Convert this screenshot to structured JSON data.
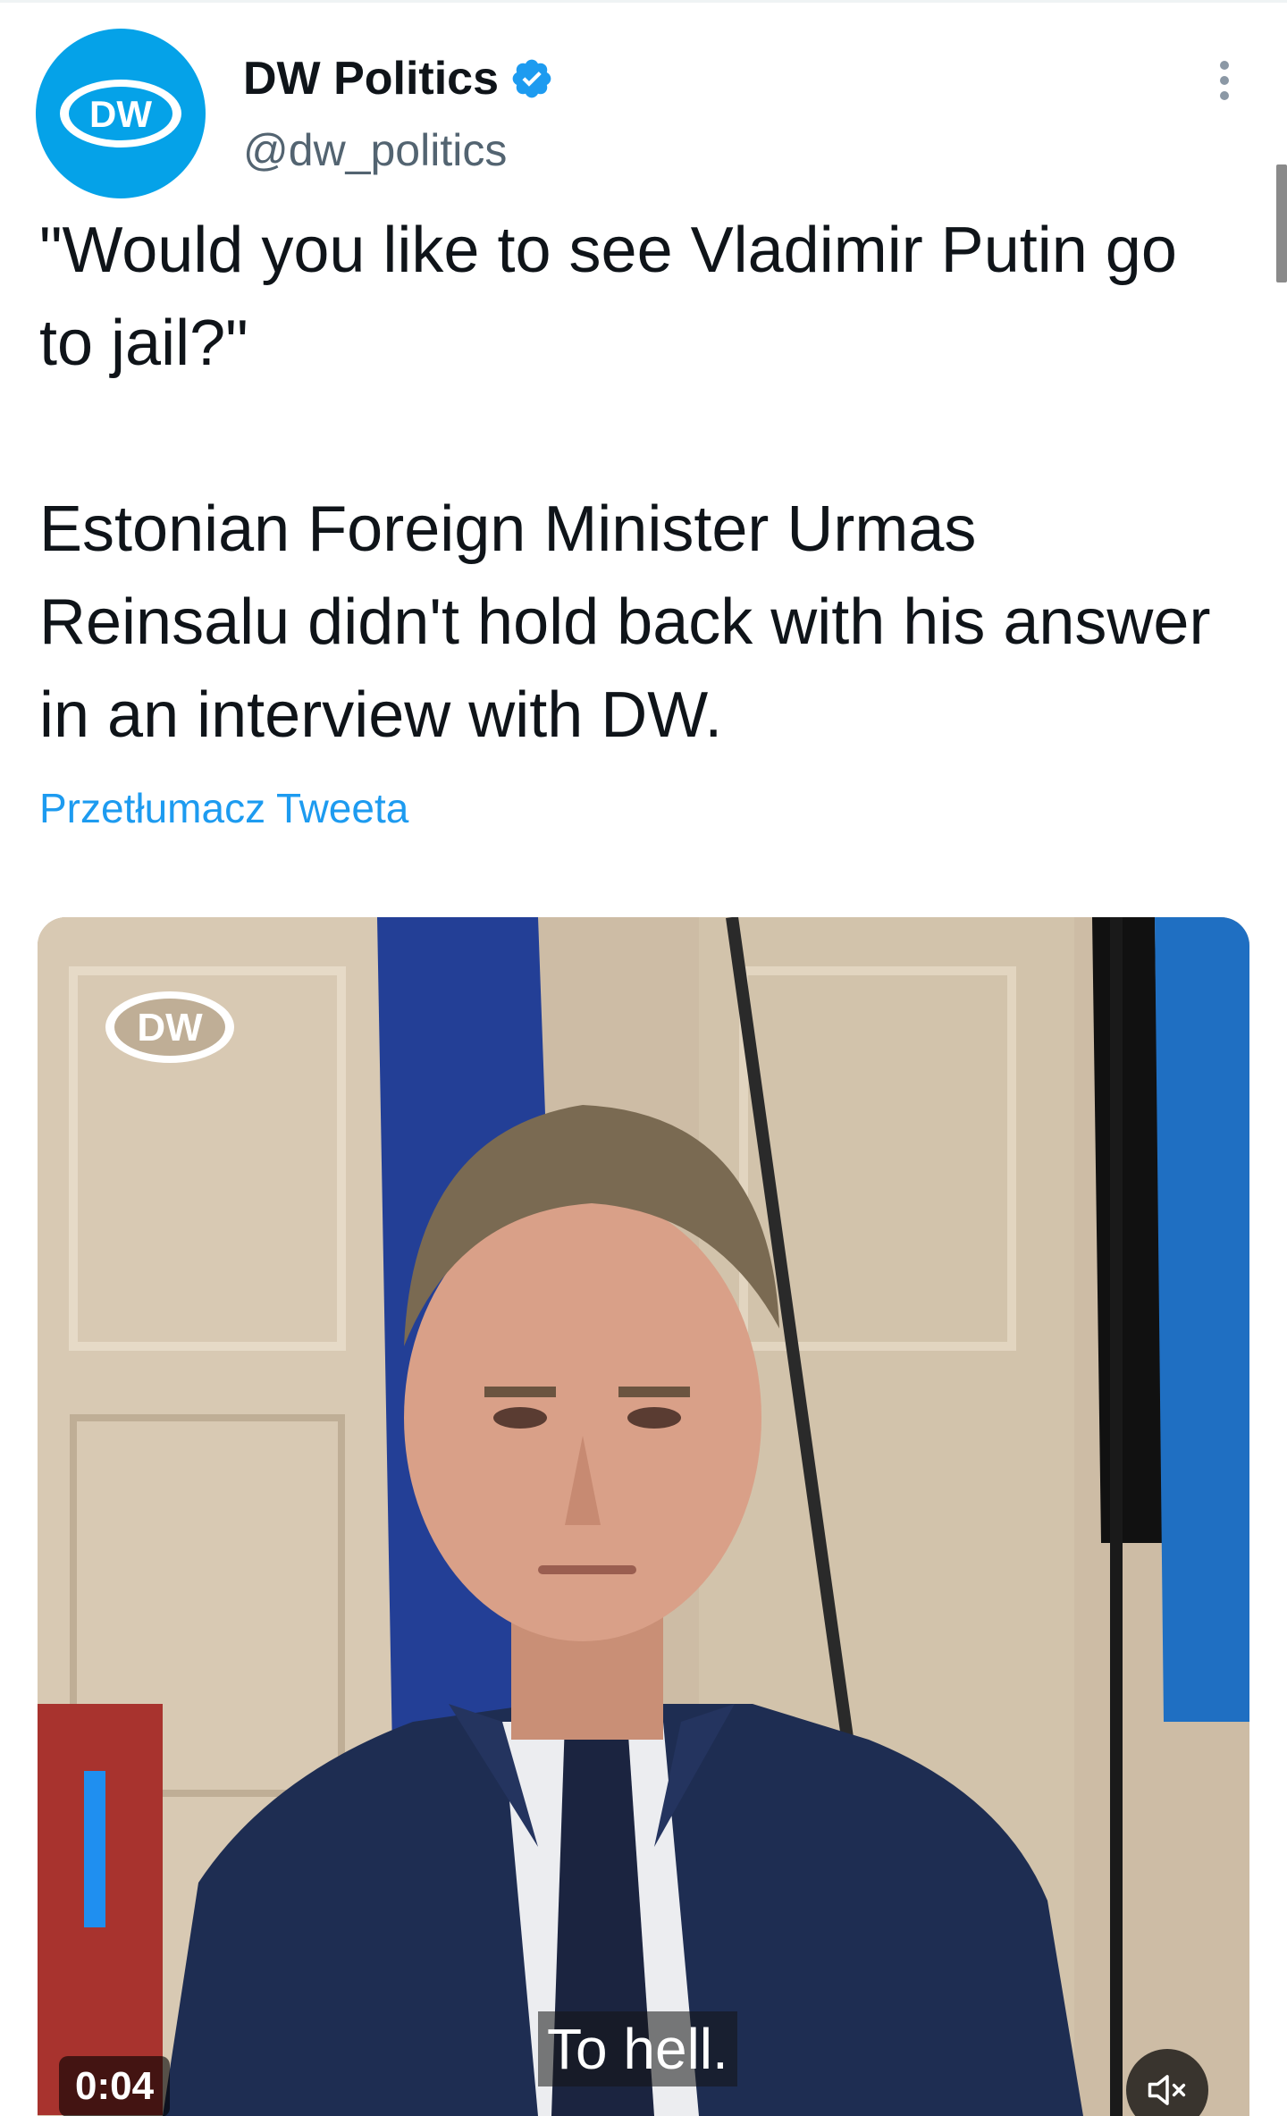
{
  "tweet": {
    "author": {
      "name": "DW Politics",
      "handle": "@dw_politics",
      "avatar_text": "DW",
      "verified": true
    },
    "text_lines": [
      "\"Would you like to see Vladimir Putin go to jail?\"",
      "Estonian Foreign Minister Urmas Reinsalu didn't hold back with his answer in an interview with DW."
    ],
    "translate_label": "Przetłumacz Tweeta",
    "more_icon": "more-vertical-icon"
  },
  "video": {
    "watermark": "DW",
    "caption": "To hell.",
    "timestamp": "0:04",
    "mute_icon": "speaker-muted-icon"
  },
  "colors": {
    "brand_blue": "#05a2e8",
    "link_blue": "#1d9bf0",
    "verified_blue": "#1d9bf0",
    "text_primary": "#0f1419",
    "text_secondary": "#536471"
  }
}
